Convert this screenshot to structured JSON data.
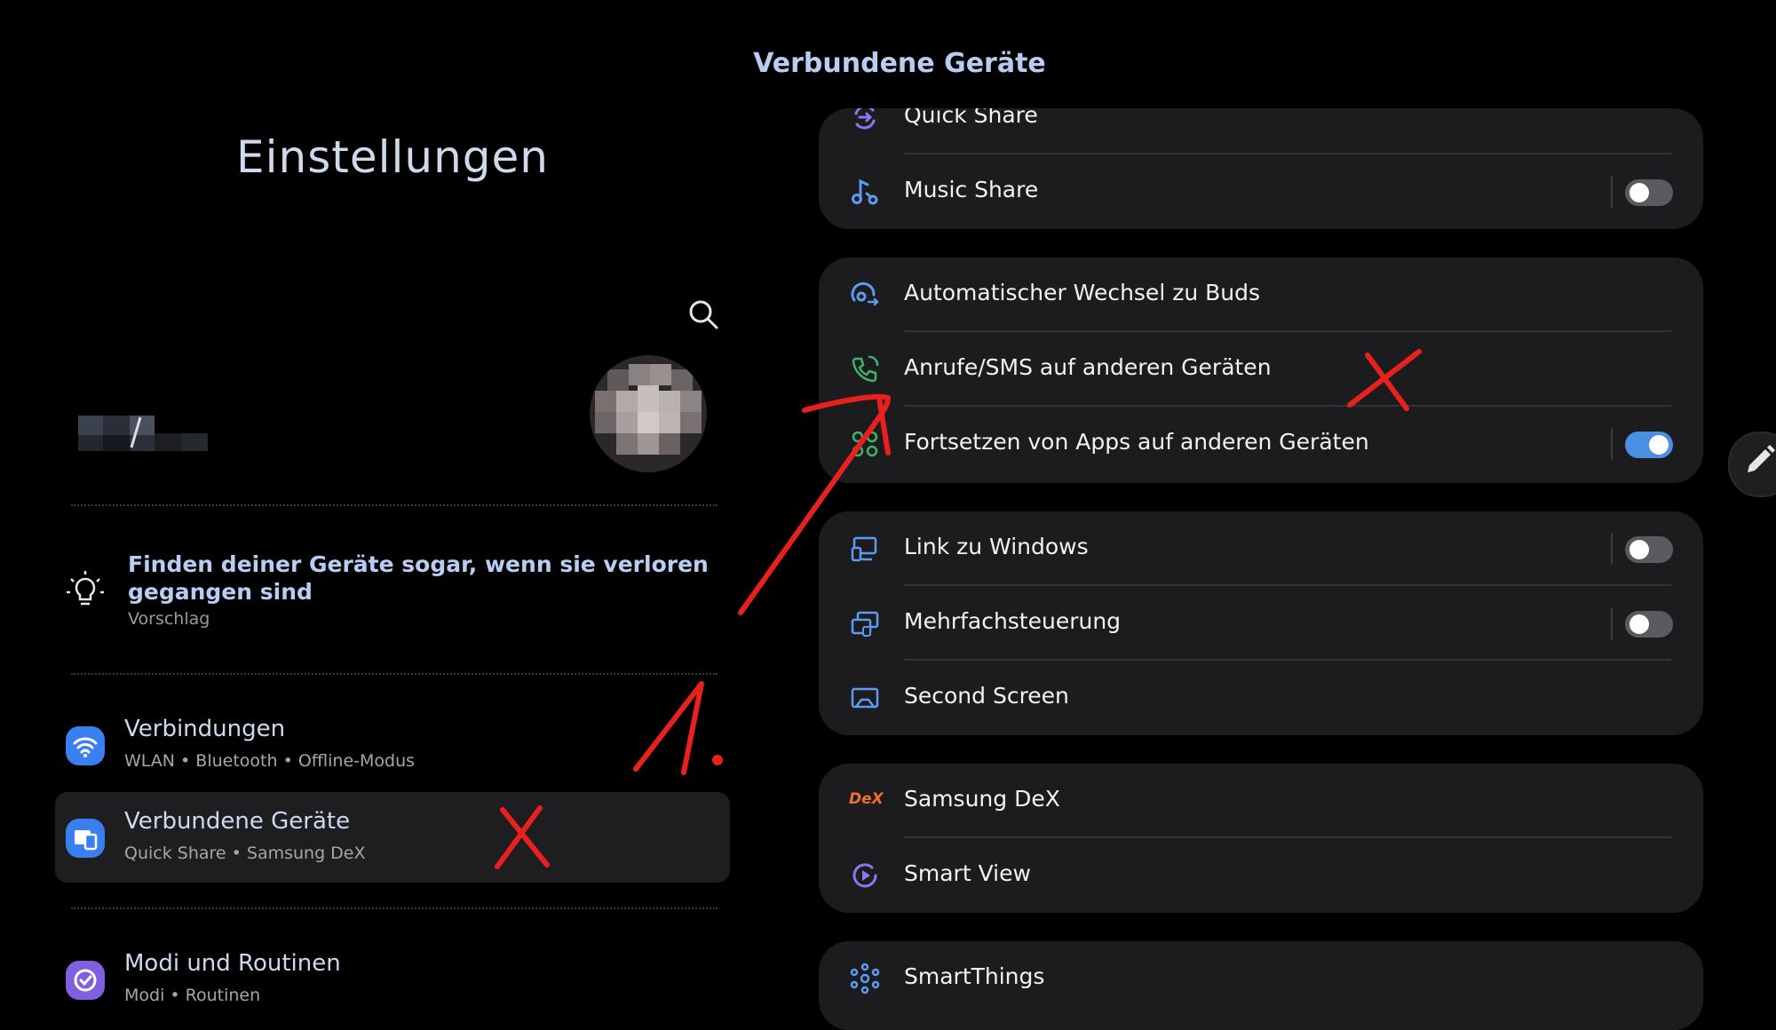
{
  "colors": {
    "background": "#000000",
    "card": "#1c1c1e",
    "accent": "#4a90e2",
    "title_blue": "#b9cdf2",
    "annotation_red": "#e8201e"
  },
  "left": {
    "title": "Einstellungen",
    "search_icon": "search-icon",
    "suggestion": {
      "icon": "lightbulb-icon",
      "title": "Finden deiner Geräte sogar, wenn sie verloren gegangen sind",
      "subtitle": "Vorschlag"
    },
    "menu": [
      {
        "icon": "wifi-icon",
        "title": "Verbindungen",
        "subtitle": "WLAN • Bluetooth • Offline-Modus",
        "selected": false
      },
      {
        "icon": "connected-devices-icon",
        "title": "Verbundene Geräte",
        "subtitle": "Quick Share • Samsung DeX",
        "selected": true
      },
      {
        "icon": "routines-icon",
        "title": "Modi und Routinen",
        "subtitle": "Modi • Routinen",
        "selected": false
      }
    ]
  },
  "right": {
    "title": "Verbundene Geräte",
    "cards": [
      {
        "rows": [
          {
            "icon": "quick-share-icon",
            "label": "Quick Share"
          },
          {
            "icon": "music-share-icon",
            "label": "Music Share",
            "toggle": false
          }
        ]
      },
      {
        "rows": [
          {
            "icon": "buds-switch-icon",
            "label": "Automatischer Wechsel zu Buds"
          },
          {
            "icon": "call-sms-icon",
            "label": "Anrufe/SMS auf anderen Geräten"
          },
          {
            "icon": "continue-apps-icon",
            "label": "Fortsetzen von Apps auf anderen Geräten",
            "toggle": true
          }
        ]
      },
      {
        "rows": [
          {
            "icon": "link-windows-icon",
            "label": "Link zu Windows",
            "toggle": false
          },
          {
            "icon": "multi-control-icon",
            "label": "Mehrfachsteuerung",
            "toggle": false
          },
          {
            "icon": "second-screen-icon",
            "label": "Second Screen"
          }
        ]
      },
      {
        "rows": [
          {
            "icon": "dex-icon",
            "label": "Samsung DeX",
            "logo_text": "DeX"
          },
          {
            "icon": "smart-view-icon",
            "label": "Smart View"
          }
        ]
      },
      {
        "rows": [
          {
            "icon": "smartthings-icon",
            "label": "SmartThings"
          }
        ]
      }
    ],
    "edit_icon": "pencil-icon"
  },
  "annotations": {
    "step_label": "1."
  }
}
